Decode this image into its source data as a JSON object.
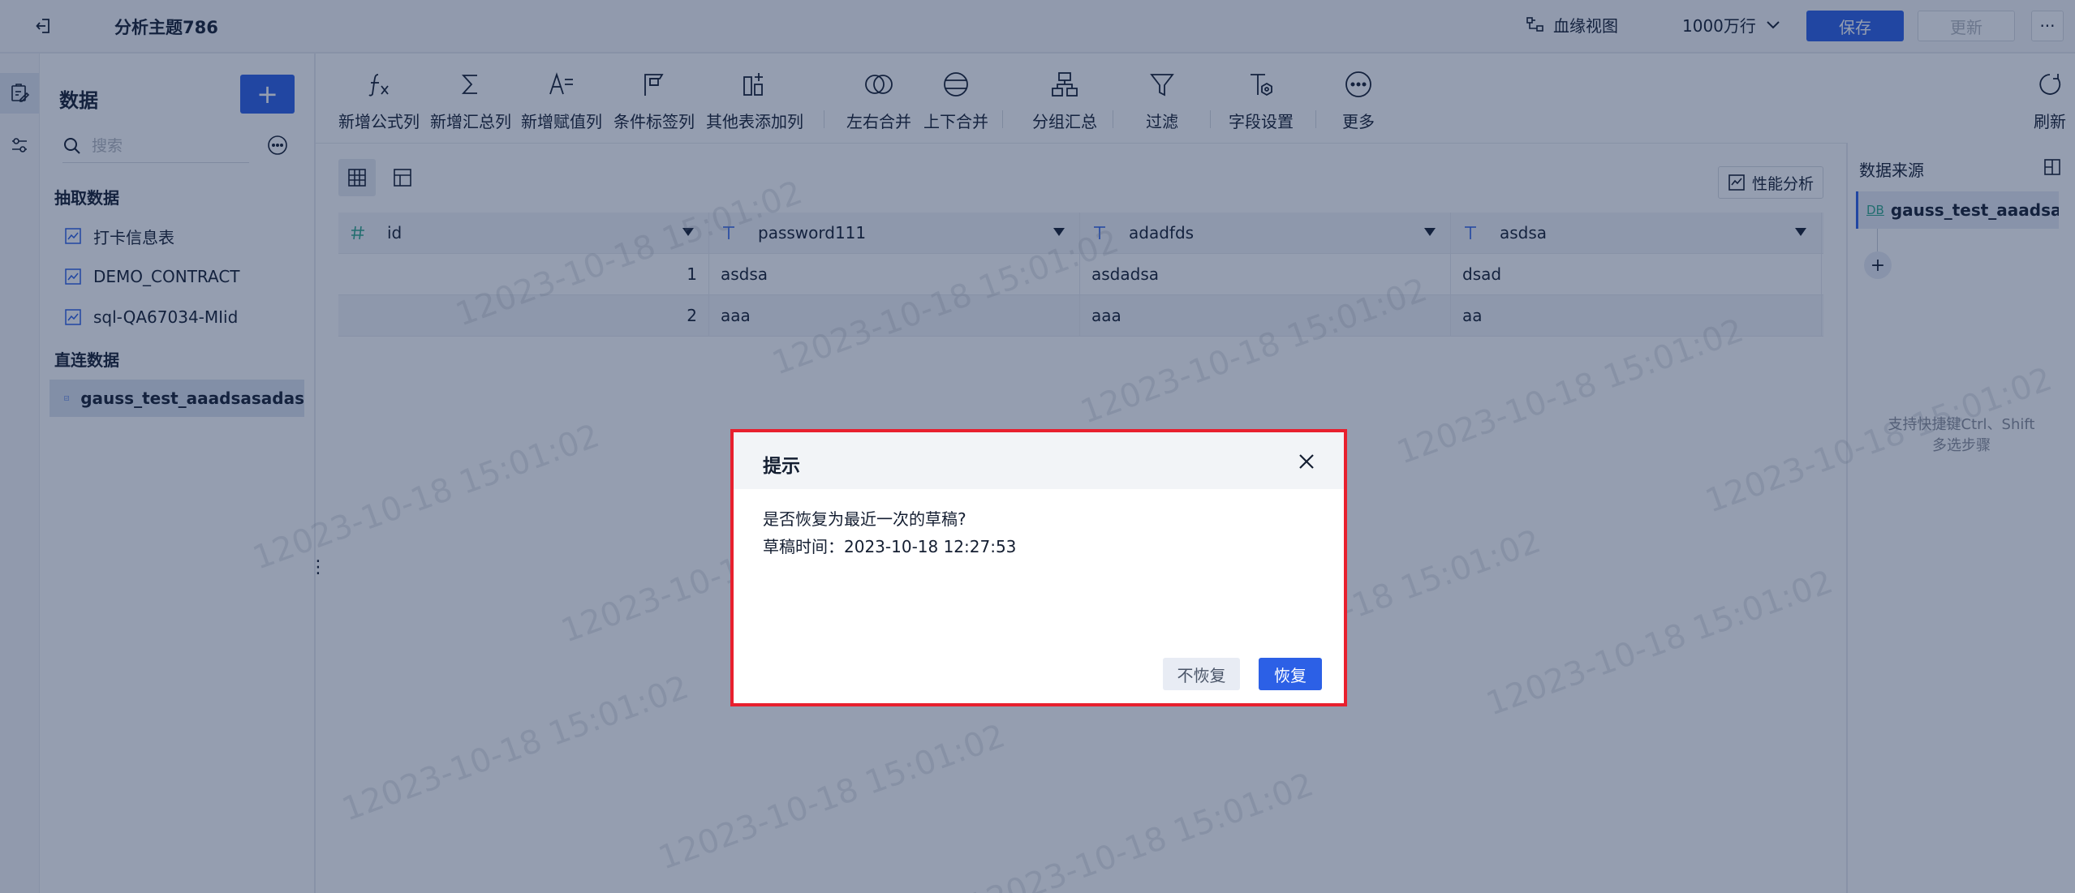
{
  "header": {
    "title": "分析主题786",
    "lineage_label": "血缘视图",
    "rows_select": "1000万行",
    "save_label": "保存",
    "update_label": "更新",
    "more_label": "···"
  },
  "data_panel": {
    "title": "数据",
    "add_label": "+",
    "search_placeholder": "搜索",
    "extract_group": "抽取数据",
    "extract_items": [
      "打卡信息表",
      "DEMO_CONTRACT",
      "sql-QA67034-MIid"
    ],
    "direct_group": "直连数据",
    "direct_items": [
      "gauss_test_aaadsasadas"
    ]
  },
  "toolbar": {
    "items": [
      "新增公式列",
      "新增汇总列",
      "新增赋值列",
      "条件标签列",
      "其他表添加列",
      "左右合并",
      "上下合并",
      "分组汇总",
      "过滤",
      "字段设置",
      "更多"
    ],
    "refresh_label": "刷新"
  },
  "perf_label": "性能分析",
  "table": {
    "columns": [
      {
        "name": "id",
        "type": "number"
      },
      {
        "name": "password111",
        "type": "text"
      },
      {
        "name": "adadfds",
        "type": "text"
      },
      {
        "name": "asdsa",
        "type": "text"
      }
    ],
    "rows": [
      [
        "1",
        "asdsa",
        "asdadsa",
        "dsad"
      ],
      [
        "2",
        "aaa",
        "aaa",
        "aa"
      ]
    ]
  },
  "right_panel": {
    "title": "数据来源",
    "source_badge": "DB",
    "source_name": "gauss_test_aaadsa...",
    "add_label": "+",
    "hint_line1": "支持快捷键Ctrl、Shift",
    "hint_line2": "多选步骤"
  },
  "watermark": "12023-10-18 15:01:02",
  "dialog": {
    "title": "提示",
    "message": "是否恢复为最近一次的草稿?",
    "draft_time": "草稿时间：2023-10-18 12:27:53",
    "cancel_label": "不恢复",
    "ok_label": "恢复"
  },
  "colors": {
    "accent": "#2c60e6",
    "highlight_border": "#e8202e"
  }
}
